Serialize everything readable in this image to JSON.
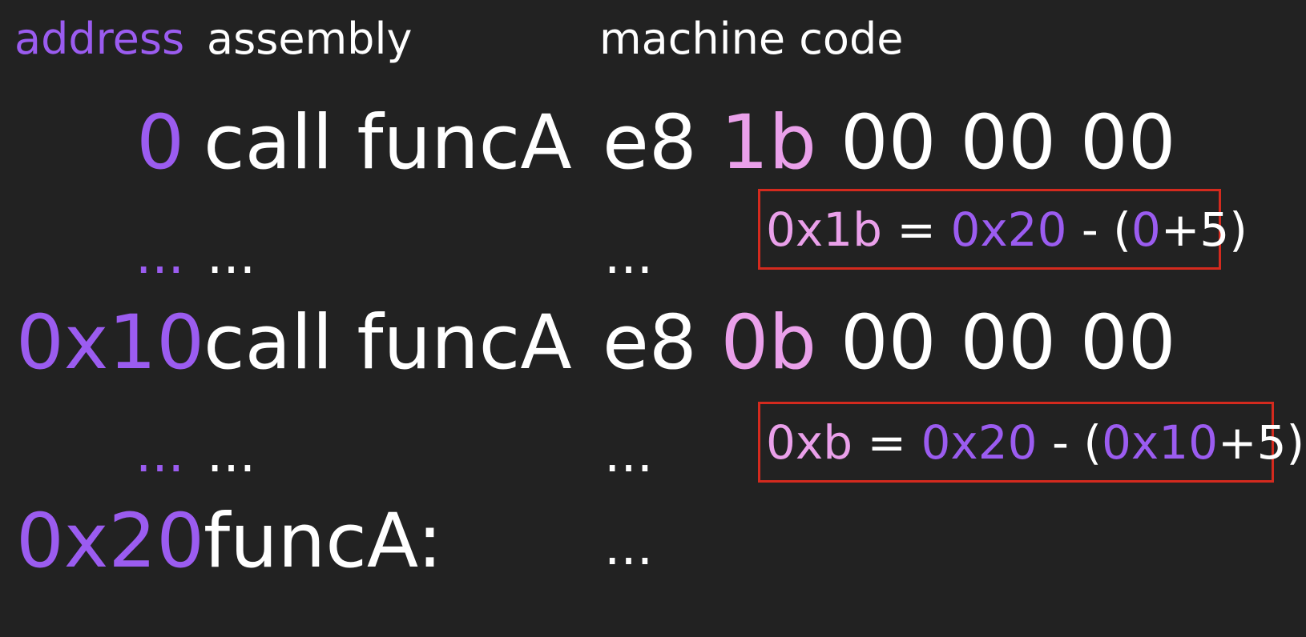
{
  "colors": {
    "background": "#222222",
    "address": "#9b5cf0",
    "offset_byte": "#eaa0ea",
    "text": "#ffffff",
    "box": "#d42a1e"
  },
  "headers": {
    "address": "address",
    "assembly": "assembly",
    "machine_code": "machine code"
  },
  "rows": [
    {
      "address": "0",
      "assembly": "call funcA",
      "opcode": "e8",
      "offset": "1b",
      "rest": "00 00 00"
    },
    {
      "address": "...",
      "assembly": "...",
      "machine": "..."
    },
    {
      "address": "0x10",
      "assembly": "call funcA",
      "opcode": "e8",
      "offset": "0b",
      "rest": "00 00 00"
    },
    {
      "address": "...",
      "assembly": "...",
      "machine": "..."
    },
    {
      "address": "0x20",
      "assembly": "funcA:",
      "machine": "..."
    }
  ],
  "formulas": [
    {
      "result": "0x1b",
      "eq": " = ",
      "target": "0x20",
      "minus": " - (",
      "addr": "0",
      "plus": "+5)"
    },
    {
      "result": "0xb",
      "eq": " = ",
      "target": "0x20",
      "minus": " - (",
      "addr": "0x10",
      "plus": "+5)"
    }
  ]
}
